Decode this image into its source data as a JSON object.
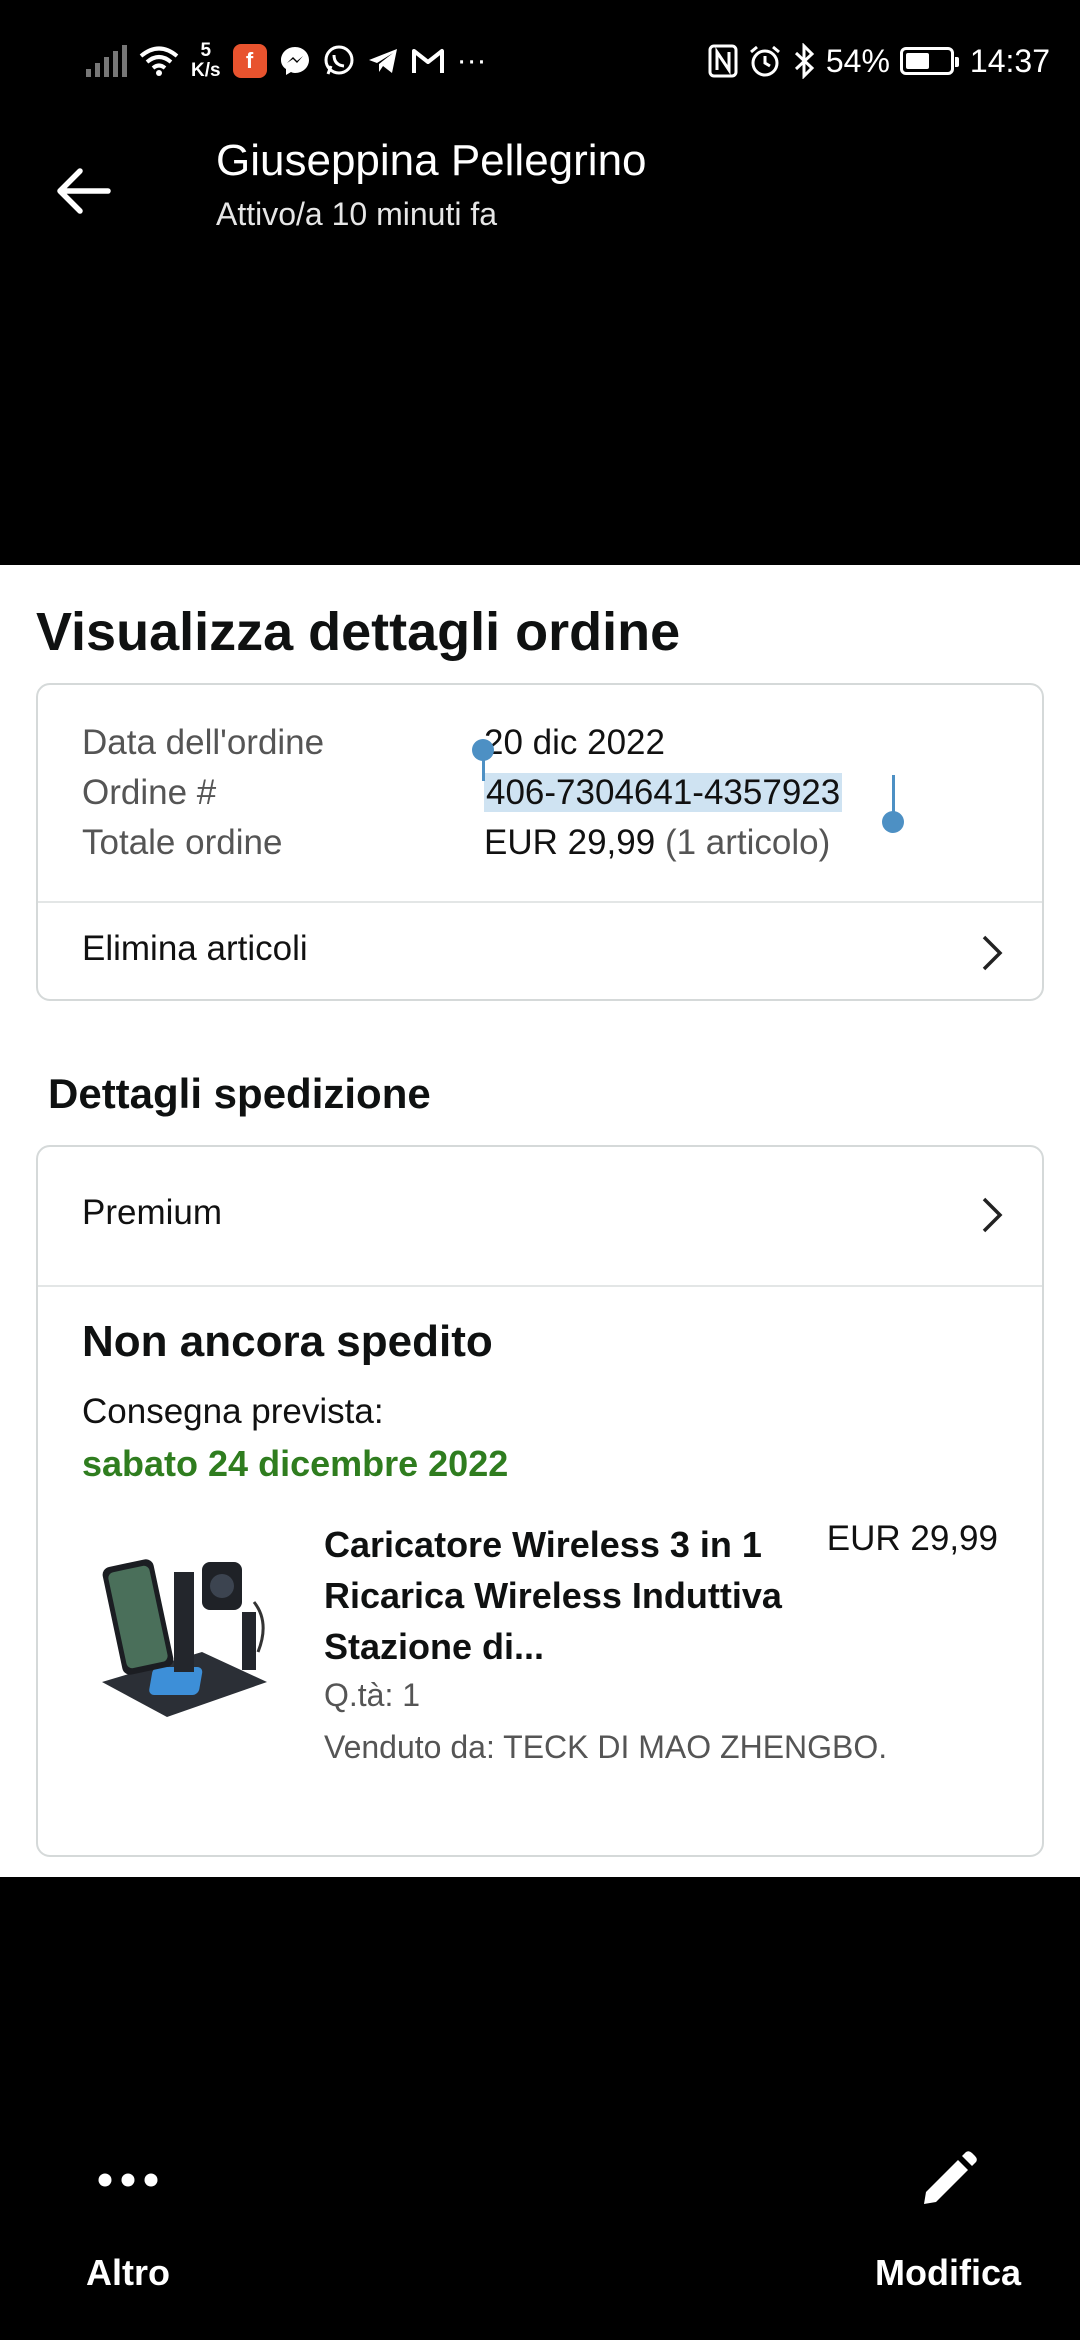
{
  "status_bar": {
    "net_speed_value": "5",
    "net_speed_unit": "K/s",
    "battery": "54%",
    "battery_level": 0.54,
    "time": "14:37",
    "more": "···"
  },
  "chat_header": {
    "contact_name": "Giuseppina Pellegrino",
    "contact_status": "Attivo/a 10 minuti fa"
  },
  "order_page": {
    "title": "Visualizza dettagli ordine",
    "summary": {
      "date_label": "Data dell'ordine",
      "date_value": "20 dic 2022",
      "order_label": "Ordine #",
      "order_value": "406-7304641-4357923",
      "total_label": "Totale ordine",
      "total_value": "EUR 29,99",
      "total_items": "(1 articolo)"
    },
    "remove_items_label": "Elimina articoli",
    "shipping_section_title": "Dettagli spedizione",
    "shipping_method": "Premium",
    "shipment_status": "Non ancora spedito",
    "delivery_label": "Consegna prevista:",
    "delivery_date": "sabato 24 dicembre 2022",
    "product": {
      "name": "Caricatore Wireless 3 in 1 Ricarica Wireless Induttiva Stazione di...",
      "price": "EUR 29,99",
      "quantity": "Q.tà: 1",
      "seller": "Venduto da: TECK DI MAO ZHENGBO."
    }
  },
  "bottom_bar": {
    "more_label": "Altro",
    "edit_label": "Modifica"
  },
  "colors": {
    "delivery_green": "#2f7d1f",
    "selection_handle": "#4d90c4",
    "selection_highlight": "#cfe3f2"
  }
}
